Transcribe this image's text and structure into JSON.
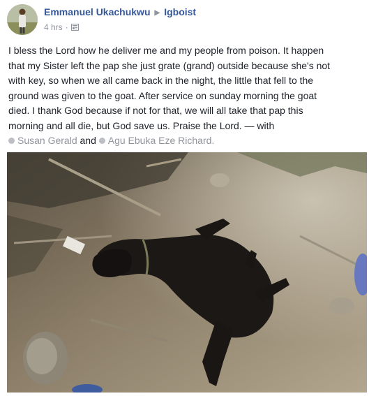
{
  "post": {
    "author": "Emmanuel Ukachukwu",
    "group": "Igboist",
    "time": "4 hrs",
    "separator": "·",
    "body_lines": [
      "I bless the Lord how he deliver me and my people from poison. It happen",
      "that my Sister left the pap she just grate (grand) outside because she's not",
      "with key, so when we all came back in the night, the little that fell to the",
      "ground was given to the goat. After service on sunday morning the goat",
      "died. I thank God because if not for that, we will all take that pap this",
      "morning and all die, but God save us. Praise the Lord. — with"
    ],
    "tagged": [
      "Susan Gerald",
      "Agu Ebuka Eze Richard"
    ],
    "tag_joiner": "and",
    "tag_end": "."
  },
  "icons": {
    "arrow": "right-triangle-icon",
    "audience": "audience-icon",
    "tag": "tagged-person-icon"
  },
  "colors": {
    "link": "#365899",
    "meta": "#90949c",
    "text": "#1d2129"
  }
}
